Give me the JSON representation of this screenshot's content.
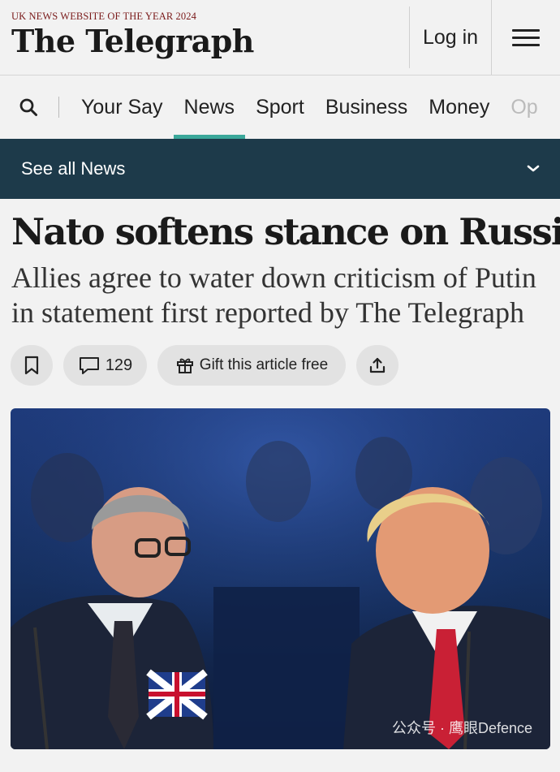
{
  "masthead": {
    "award": "UK NEWS WEBSITE OF THE YEAR 2024",
    "logo": "The Telegraph",
    "login_label": "Log in",
    "menu_icon": "hamburger-icon"
  },
  "nav": {
    "search_icon": "search-icon",
    "items": [
      {
        "label": "Your Say",
        "active": false
      },
      {
        "label": "News",
        "active": true
      },
      {
        "label": "Sport",
        "active": false
      },
      {
        "label": "Business",
        "active": false
      },
      {
        "label": "Money",
        "active": false
      },
      {
        "label": "Op",
        "active": false
      }
    ],
    "active_color": "#3aa79a"
  },
  "subnav": {
    "label": "See all News",
    "icon": "chevron-down-icon",
    "background": "#1d3a4a"
  },
  "article": {
    "headline": "Nato softens stance on Russia",
    "standfirst": "Allies agree to water down criticism of Putin in statement first reported by The Telegraph",
    "actions": {
      "bookmark_icon": "bookmark-icon",
      "comment_count": "129",
      "comment_icon": "comment-icon",
      "gift_label": "Gift this article free",
      "gift_icon": "gift-icon",
      "share_icon": "share-icon"
    }
  },
  "photo": {
    "watermark": "公众号 · 鹰眼Defence"
  }
}
